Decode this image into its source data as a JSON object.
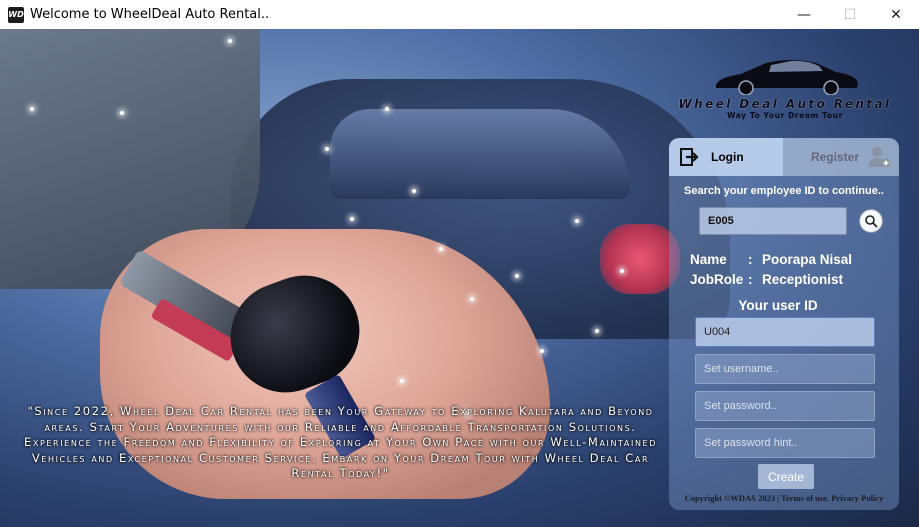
{
  "window": {
    "title": "Welcome to WheelDeal Auto Rental..",
    "icon_text": "WD",
    "minimize": "—",
    "maximize": "☐",
    "close": "✕"
  },
  "logo": {
    "title": "Wheel Deal Auto Rental",
    "tagline": "Way To Your Dream Tour"
  },
  "slogan": "\"Since 2022, Wheel Deal Car Rental has been Your Gateway to Exploring Kalutara and Beyond areas. Start Your Adventures with our Reliable and Affordable Transportation Solutions. Experience the Freedom and Flexibility of Exploring at Your Own Pace with our Well-Maintained Vehicles and Exceptional Customer Service. Embark on Your Dream Tour with Wheel Deal Car Rental Today!\"",
  "tabs": {
    "login": "Login",
    "register": "Register"
  },
  "search": {
    "label": "Search your employee ID to continue..",
    "value": "E005"
  },
  "employee": {
    "name_key": "Name",
    "name_sep": ":",
    "name_value": "Poorapa Nisal",
    "role_key": "JobRole",
    "role_sep": ":",
    "role_value": "Receptionist"
  },
  "form": {
    "user_id_label": "Your user ID",
    "user_id_value": "U004",
    "username_placeholder": "Set username..",
    "password_placeholder": "Set password..",
    "hint_placeholder": "Set password hint..",
    "create_label": "Create"
  },
  "footer": {
    "copyright": "Copyright ©WDAS 2023 | Terms of use. Privacy Policy"
  },
  "colors": {
    "panel_bg": "#7896c8",
    "accent_input": "#5f7fb8"
  }
}
